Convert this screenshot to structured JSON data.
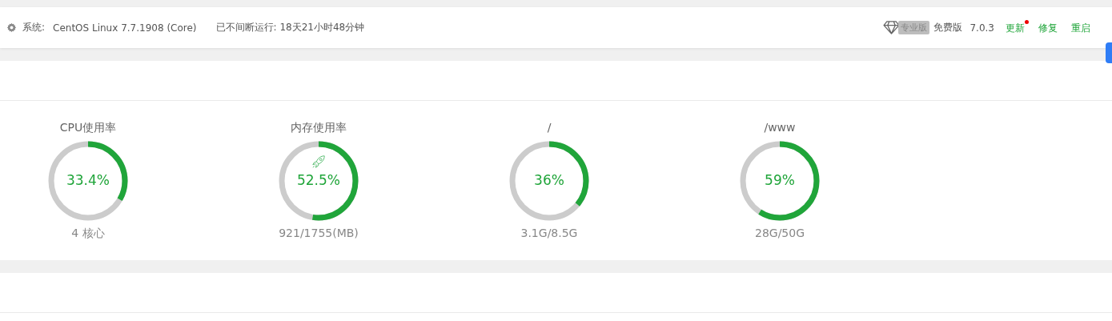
{
  "header": {
    "system_label": "系统:",
    "system_value": "CentOS Linux 7.7.1908 (Core)",
    "uptime": "已不间断运行: 18天21小时48分钟",
    "pro_badge": "专业版",
    "edition": "免费版",
    "version": "7.0.3",
    "actions": [
      {
        "label": "更新",
        "notify": true
      },
      {
        "label": "修复",
        "notify": false
      },
      {
        "label": "重启",
        "notify": false
      }
    ]
  },
  "gauges": [
    {
      "title": "CPU使用率",
      "value": "33.4%",
      "level": 0.334,
      "boost": false,
      "detail": "4 核心"
    },
    {
      "title": "内存使用率",
      "value": "52.5%",
      "level": 0.525,
      "boost": true,
      "detail": "921/1755(MB)"
    },
    {
      "title": "/",
      "value": "36%",
      "level": 0.36,
      "boost": false,
      "detail": "3.1G/8.5G"
    },
    {
      "title": "/www",
      "value": "59%",
      "level": 0.59,
      "boost": false,
      "detail": "28G/50G"
    }
  ]
}
